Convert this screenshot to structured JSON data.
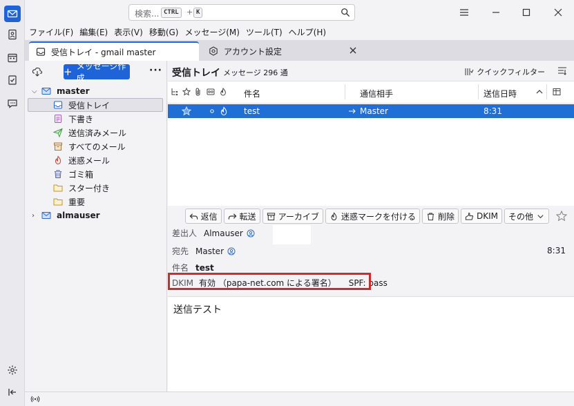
{
  "search": {
    "placeholder": "検索...",
    "key1": "CTRL",
    "plus": "+",
    "key2": "K"
  },
  "menu": [
    "ファイル(F)",
    "編集(E)",
    "表示(V)",
    "移動(G)",
    "メッセージ(M)",
    "ツール(T)",
    "ヘルプ(H)"
  ],
  "tabs": [
    {
      "label": "受信トレイ - gmail master",
      "icon": "inbox-icon"
    },
    {
      "label": "アカウント設定",
      "icon": "settings-icon"
    }
  ],
  "folder_pane": {
    "compose_label": "メッセージ作成",
    "accounts": [
      {
        "name": "master",
        "folders": [
          {
            "label": "受信トレイ",
            "icon": "inbox-icon",
            "selected": true
          },
          {
            "label": "下書き",
            "icon": "draft-icon"
          },
          {
            "label": "送信済みメール",
            "icon": "sent-icon"
          },
          {
            "label": "すべてのメール",
            "icon": "archive-icon"
          },
          {
            "label": "迷惑メール",
            "icon": "junk-icon"
          },
          {
            "label": "ゴミ箱",
            "icon": "trash-icon"
          },
          {
            "label": "スター付き",
            "icon": "folder-icon"
          },
          {
            "label": "重要",
            "icon": "folder-icon"
          }
        ]
      },
      {
        "name": "almauser",
        "folders": []
      }
    ]
  },
  "thread_pane": {
    "title": "受信トレイ",
    "count": "メッセージ 296 通",
    "quick_filter": "クイックフィルター",
    "columns": {
      "subject": "件名",
      "correspondent": "通信相手",
      "date": "送信日時"
    },
    "rows": [
      {
        "subject": "test",
        "correspondent": "Master",
        "date": "8:31",
        "selected": true
      }
    ]
  },
  "message": {
    "actions": [
      "返信",
      "転送",
      "アーカイブ",
      "迷惑マークを付ける",
      "削除",
      "DKIM",
      "その他"
    ],
    "from_label": "差出人",
    "from_value": "Almauser",
    "to_label": "宛先",
    "to_value": "Master",
    "date": "8:31",
    "subject_label": "件名",
    "subject_value": "test",
    "dkim_label": "DKIM",
    "dkim_value": "有効 （papa-net.com による署名）",
    "spf": "SPF: pass",
    "body": "送信テスト"
  },
  "colors": {
    "accent": "#1f63d8",
    "selection": "#1f6fd6",
    "highlight_box": "#d12a2a"
  }
}
